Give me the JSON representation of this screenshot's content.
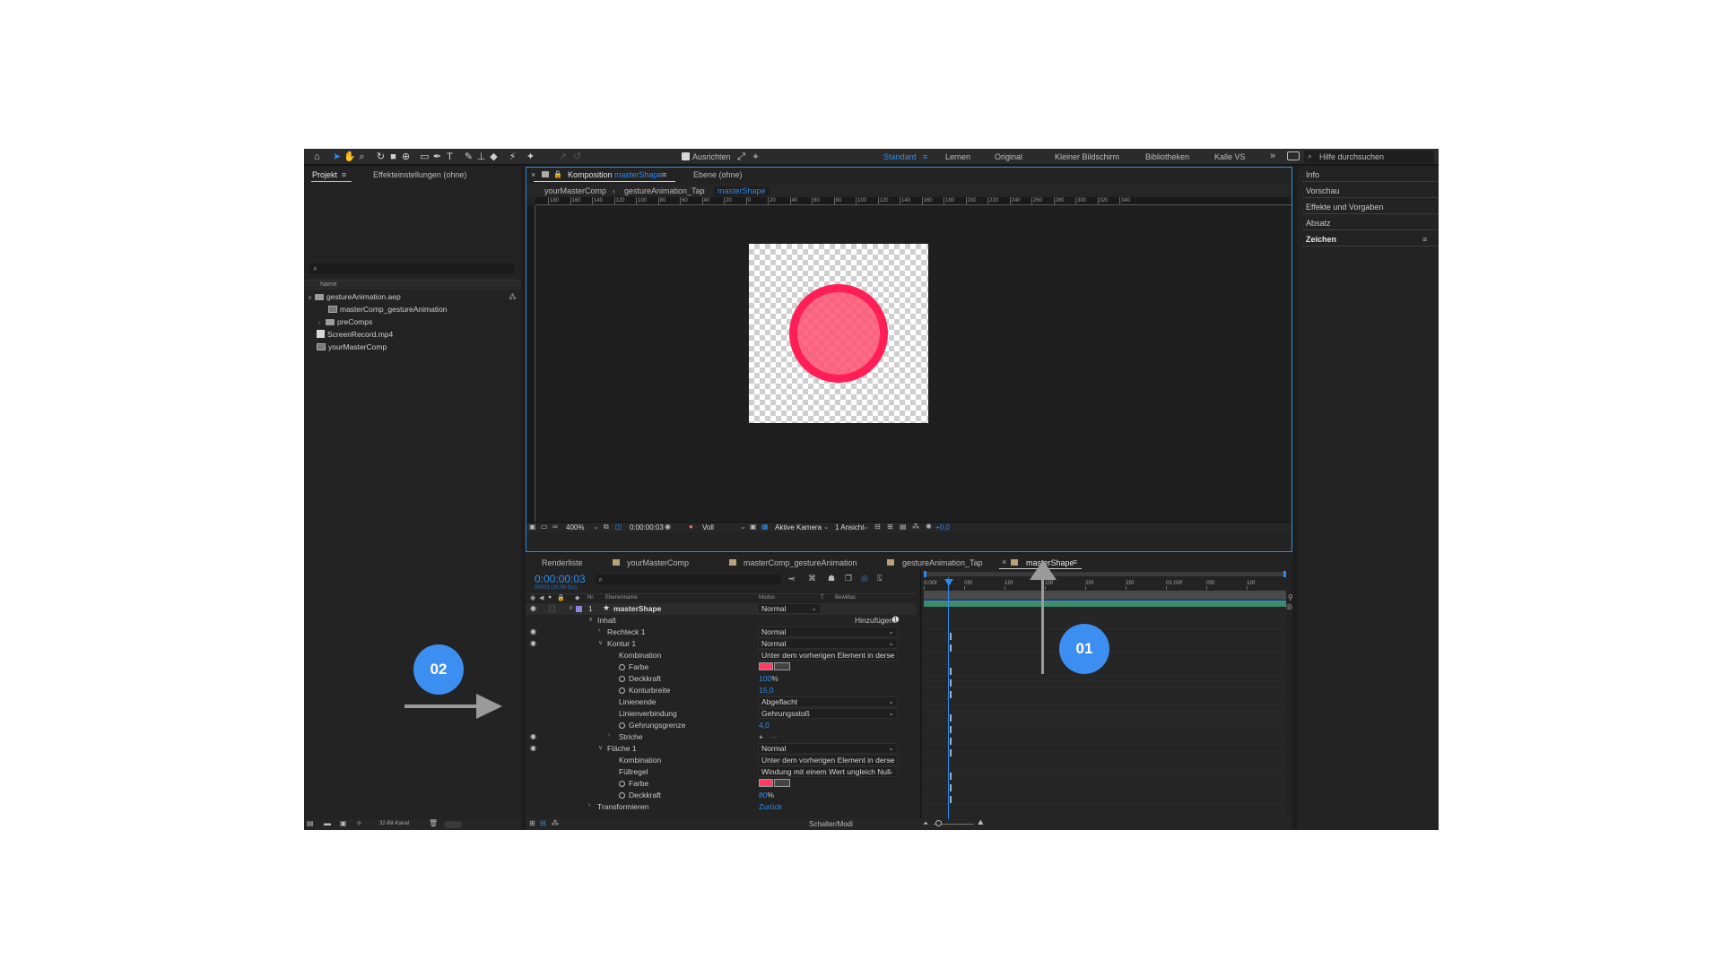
{
  "toolbar": {
    "align_label": "Ausrichten",
    "workspaces": [
      "Standard",
      "Lernen",
      "Original",
      "Kleiner Bildschirm",
      "Bibliotheken",
      "Kalle VS"
    ],
    "more": "»",
    "search_placeholder": "Hilfe durchsuchen"
  },
  "project_panel": {
    "tab_project": "Projekt",
    "tab_effects": "Effekteinstellungen (ohne)",
    "column_name": "Name",
    "items": [
      {
        "label": "gestureAnimation.aep",
        "type": "folder"
      },
      {
        "label": "masterComp_gestureAnimation",
        "type": "comp"
      },
      {
        "label": "preComps",
        "type": "folder"
      },
      {
        "label": "ScreenRecord.mp4",
        "type": "video"
      },
      {
        "label": "yourMasterComp",
        "type": "comp"
      }
    ],
    "bit_depth": "32-Bit-Kanal"
  },
  "composition_panel": {
    "tab_prefix": "Komposition",
    "tab_comp_name": "masterShape",
    "tab_layer": "Ebene (ohne)",
    "breadcrumbs": [
      "yourMasterComp",
      "gestureAnimation_Tap",
      "masterShape"
    ],
    "ruler_ticks": [
      "180",
      "160",
      "140",
      "120",
      "100",
      "80",
      "60",
      "40",
      "20",
      "0",
      "20",
      "40",
      "60",
      "80",
      "100",
      "120",
      "140",
      "160",
      "180",
      "200",
      "220",
      "240",
      "260",
      "280",
      "300",
      "320",
      "340"
    ],
    "zoom": "400%",
    "timecode": "0:00:00:03",
    "resolution": "Voll",
    "camera": "Aktive Kamera",
    "views": "1 Ansicht",
    "exposure": "+0,0"
  },
  "right_panel": {
    "items": [
      "Info",
      "Vorschau",
      "Effekte und Vorgaben",
      "Absatz",
      "Zeichen"
    ]
  },
  "timeline_tabs": [
    "Renderliste",
    "yourMasterComp",
    "masterComp_gestureAnimation",
    "gestureAnimation_Tap",
    "masterShape"
  ],
  "timeline": {
    "timecode": "0:00:00:03",
    "frame_info": "00003 (30.00 fps)",
    "col_nr": "Nr.",
    "col_layer_name": "Ebenenname",
    "col_mode": "Modus",
    "col_t": "T",
    "col_bewmas": "BewMas",
    "layer_num": "1",
    "layer_name": "masterShape",
    "layer_mode": "Normal",
    "content": "Inhalt",
    "add": "Hinzufügen:",
    "rect": "Rechteck 1",
    "rect_mode": "Normal",
    "stroke": "Kontur 1",
    "stroke_mode": "Normal",
    "combination": "Kombination",
    "combination_val": "Unter dem vorherigen Element in derse",
    "color": "Farbe",
    "opacity": "Deckkraft",
    "opacity_val": "100",
    "percent": "%",
    "stroke_width": "Konturbreite",
    "stroke_width_val": "15,0",
    "line_cap": "Linienende",
    "line_cap_val": "Abgeflacht",
    "line_join": "Linienverbindung",
    "line_join_val": "Gehrungsstoß",
    "miter": "Gehrungsgrenze",
    "miter_val": "4,0",
    "dashes": "Striche",
    "dashes_add": "+",
    "dashes_sep": "—",
    "fill": "Fläche 1",
    "fill_mode": "Normal",
    "combination2_val": "Unter dem vorherigen Element in derse",
    "fill_rule": "Füllregel",
    "fill_rule_val": "Windung mit einem Wert ungleich Null",
    "fill_color": "Farbe",
    "fill_opacity": "Deckkraft",
    "fill_opacity_val": "80",
    "transform": "Transformieren",
    "reset": "Zurück",
    "switches": "Schalter/Modi",
    "ruler_labels": [
      "0:00f",
      "05f",
      "10f",
      "15f",
      "20f",
      "25f",
      "01:00f",
      "05f",
      "10f"
    ]
  },
  "colors": {
    "accent": "#2d8ceb",
    "shape_stroke": "#ff1f56",
    "shape_fill": "#ff6b86",
    "callout": "#3c8ff0",
    "layer_bar": "#3c8c6c"
  },
  "callouts": {
    "one": "01",
    "two": "02"
  }
}
